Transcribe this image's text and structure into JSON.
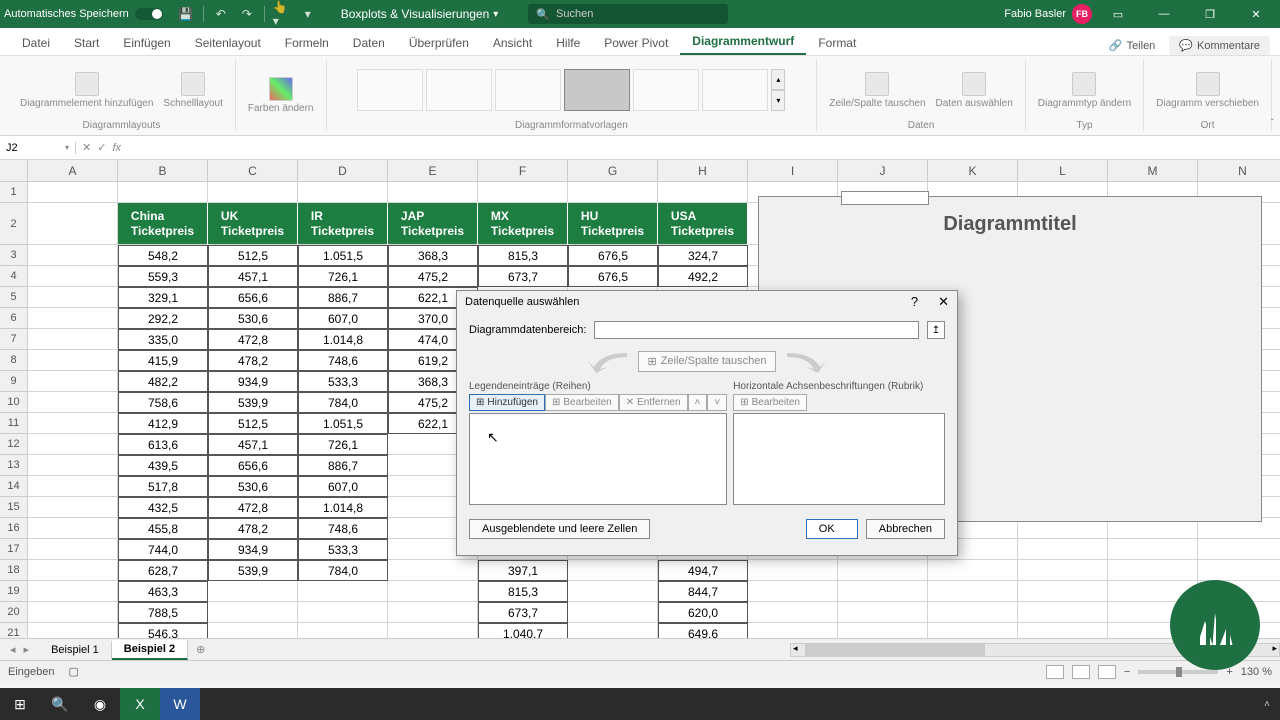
{
  "titlebar": {
    "autosave": "Automatisches Speichern",
    "docname": "Boxplots & Visualisierungen",
    "search_placeholder": "Suchen",
    "username": "Fabio Basler",
    "user_initials": "FB"
  },
  "tabs": {
    "items": [
      "Datei",
      "Start",
      "Einfügen",
      "Seitenlayout",
      "Formeln",
      "Daten",
      "Überprüfen",
      "Ansicht",
      "Hilfe",
      "Power Pivot",
      "Diagrammentwurf",
      "Format"
    ],
    "active": "Diagrammentwurf",
    "share": "Teilen",
    "comments": "Kommentare"
  },
  "ribbon": {
    "groups": [
      {
        "label": "Diagrammlayouts",
        "items": [
          "Diagrammelement hinzufügen",
          "Schnelllayout"
        ]
      },
      {
        "label": "",
        "items": [
          "Farben ändern"
        ]
      },
      {
        "label": "Diagrammformatvorlagen"
      },
      {
        "label": "Daten",
        "items": [
          "Zeile/Spalte tauschen",
          "Daten auswählen"
        ]
      },
      {
        "label": "Typ",
        "items": [
          "Diagrammtyp ändern"
        ]
      },
      {
        "label": "Ort",
        "items": [
          "Diagramm verschieben"
        ]
      }
    ]
  },
  "namebox": "J2",
  "columns": [
    "A",
    "B",
    "C",
    "D",
    "E",
    "F",
    "G",
    "H",
    "I",
    "J",
    "K",
    "L",
    "M",
    "N"
  ],
  "headers": [
    "China Ticketpreis",
    "UK Ticketpreis",
    "IR Ticketpreis",
    "JAP Ticketpreis",
    "MX Ticketpreis",
    "HU Ticketpreis",
    "USA Ticketpreis"
  ],
  "data_rows": [
    [
      "548,2",
      "512,5",
      "1.051,5",
      "368,3",
      "815,3",
      "676,5",
      "324,7"
    ],
    [
      "559,3",
      "457,1",
      "726,1",
      "475,2",
      "673,7",
      "676,5",
      "492,2"
    ],
    [
      "329,1",
      "656,6",
      "886,7",
      "622,1",
      "",
      "",
      ""
    ],
    [
      "292,2",
      "530,6",
      "607,0",
      "370,0",
      "",
      "",
      ""
    ],
    [
      "335,0",
      "472,8",
      "1.014,8",
      "474,0",
      "",
      "",
      ""
    ],
    [
      "415,9",
      "478,2",
      "748,6",
      "619,2",
      "",
      "",
      ""
    ],
    [
      "482,2",
      "934,9",
      "533,3",
      "368,3",
      "",
      "",
      ""
    ],
    [
      "758,6",
      "539,9",
      "784,0",
      "475,2",
      "",
      "",
      ""
    ],
    [
      "412,9",
      "512,5",
      "1.051,5",
      "622,1",
      "",
      "",
      ""
    ],
    [
      "613,6",
      "457,1",
      "726,1",
      "",
      "",
      "",
      ""
    ],
    [
      "439,5",
      "656,6",
      "886,7",
      "",
      "",
      "",
      ""
    ],
    [
      "517,8",
      "530,6",
      "607,0",
      "",
      "",
      "",
      ""
    ],
    [
      "432,5",
      "472,8",
      "1.014,8",
      "",
      "",
      "",
      ""
    ],
    [
      "455,8",
      "478,2",
      "748,6",
      "",
      "",
      "",
      ""
    ],
    [
      "744,0",
      "934,9",
      "533,3",
      "",
      "",
      "",
      ""
    ],
    [
      "628,7",
      "539,9",
      "784,0",
      "",
      "397,1",
      "",
      "494,7"
    ],
    [
      "463,3",
      "",
      "",
      "",
      "815,3",
      "",
      "844,7"
    ],
    [
      "788,5",
      "",
      "",
      "",
      "673,7",
      "",
      "620,0"
    ],
    [
      "546,3",
      "",
      "",
      "",
      "1.040,7",
      "",
      "649,6"
    ]
  ],
  "chart": {
    "title": "Diagrammtitel"
  },
  "dialog": {
    "title": "Datenquelle auswählen",
    "range_label": "Diagrammdatenbereich:",
    "switch": "Zeile/Spalte tauschen",
    "legend_label": "Legendeneinträge (Reihen)",
    "axis_label": "Horizontale Achsenbeschriftungen (Rubrik)",
    "btn_add": "Hinzufügen",
    "btn_edit": "Bearbeiten",
    "btn_remove": "Entfernen",
    "btn_edit2": "Bearbeiten",
    "btn_hidden": "Ausgeblendete und leere Zellen",
    "btn_ok": "OK",
    "btn_cancel": "Abbrechen"
  },
  "sheets": {
    "tabs": [
      "Beispiel 1",
      "Beispiel 2"
    ],
    "active": 1
  },
  "status": {
    "mode": "Eingeben",
    "zoom": "130 %"
  },
  "taskbar": {
    "time": ""
  }
}
